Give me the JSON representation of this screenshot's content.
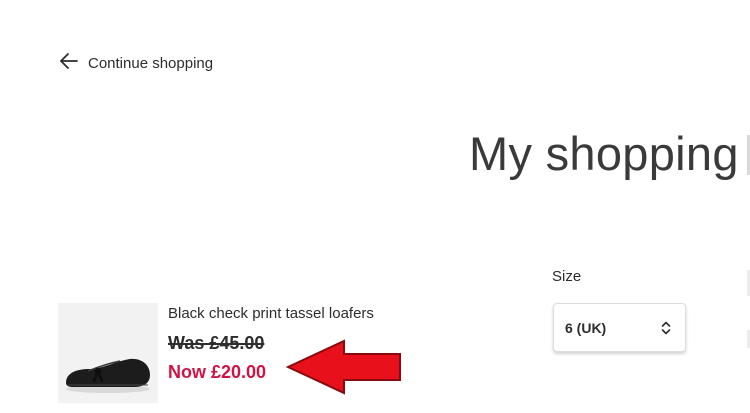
{
  "nav": {
    "continue_label": "Continue shopping",
    "back_icon": "arrow-left-icon"
  },
  "page": {
    "title": "My shopping"
  },
  "product": {
    "name": "Black check print tassel loafers",
    "was_price": "Was £45.00",
    "now_price": "Now £20.00",
    "image_icon": "loafer-shoe-image"
  },
  "size": {
    "label": "Size",
    "selected": "6 (UK)",
    "chevron_icon": "chevron-up-down-icon"
  },
  "annotation": {
    "arrow_icon": "red-arrow-left-icon",
    "arrow_color": "#e8101a"
  },
  "colors": {
    "sale_price": "#d01345",
    "text": "#2d2d2d"
  }
}
